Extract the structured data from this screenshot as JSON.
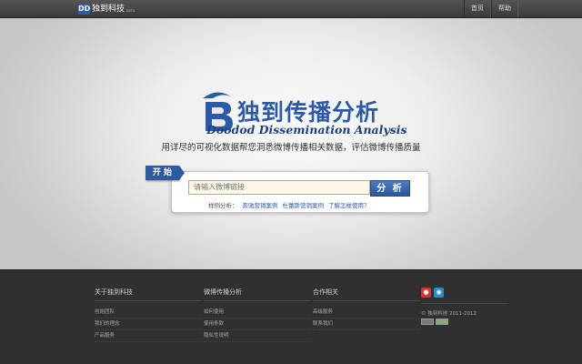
{
  "topbar": {
    "brand_logo_text": "DD",
    "brand_name": "独到科技",
    "brand_sub": "beta",
    "nav": [
      "首页",
      "帮助"
    ]
  },
  "hero": {
    "title_cn": "独到传播分析",
    "title_en": "Doodod Dissemination Analysis",
    "tagline": "用详尽的可视化数据帮您洞悉微博传播相关数据，评估微博传播质量",
    "start_label": "开 始",
    "search_placeholder": "请输入微博链接",
    "search_button": "分 析",
    "examples_label": "样例分析：",
    "examples": [
      "奔驰营销案例",
      "杜蕾斯营销案例",
      "了解怎样使用？"
    ]
  },
  "footer": {
    "columns": [
      {
        "title": "关于独到科技",
        "links": [
          "创始团队",
          "我们的理念",
          "产品服务"
        ]
      },
      {
        "title": "微博传播分析",
        "links": [
          "如何使用",
          "使用条款",
          "隐私性说明"
        ]
      },
      {
        "title": "合作相关",
        "links": [
          "高级服务",
          "联系我们"
        ]
      }
    ],
    "copyright": "© 独到科技 2011-2012",
    "colors": {
      "weibo": "#d6352b",
      "qq": "#2a8bd1"
    }
  }
}
